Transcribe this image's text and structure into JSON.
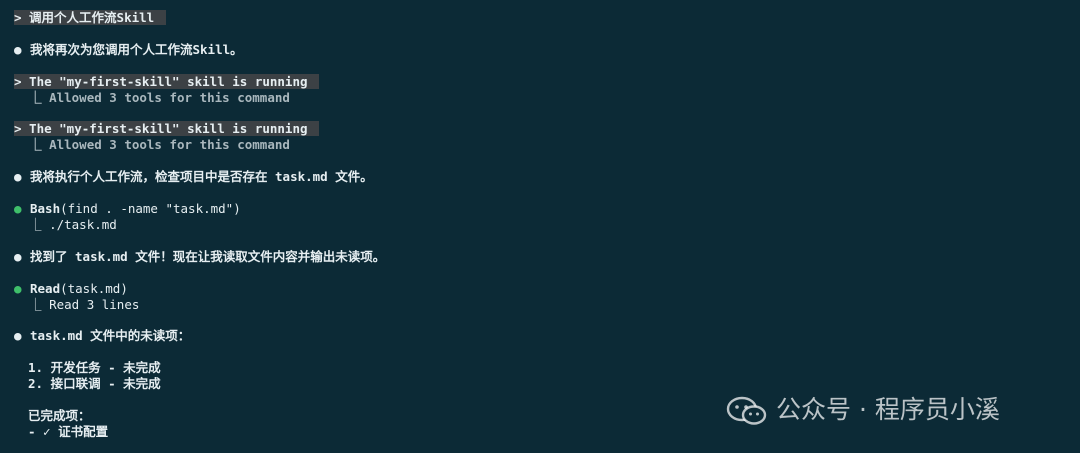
{
  "terminal": {
    "l1": "> 调用个人工作流Skill ",
    "l2": "我将再次为您调用个人工作流Skill。",
    "l3": "> The \"my-first-skill\" skill is running ",
    "l4": "  ⎿ Allowed 3 tools for this command",
    "l5": "> The \"my-first-skill\" skill is running ",
    "l6": "  ⎿ Allowed 3 tools for this command",
    "l7": "我将执行个人工作流，检查项目中是否存在 task.md 文件。",
    "bash_tool": "Bash",
    "bash_args": "(find . -name \"task.md\")",
    "bash_result": "  ⎿ ./task.md",
    "l10": "找到了 task.md 文件！现在让我读取文件内容并输出未读项。",
    "read_tool": "Read",
    "read_args": "(task.md)",
    "read_result": "  ⎿ Read 3 lines",
    "l13": "task.md 文件中的未读项：",
    "item1": "1. 开发任务 - 未完成",
    "item2": "2. 接口联调 - 未完成",
    "done_heading": "已完成项：",
    "done1": "- ✓ 证书配置",
    "bullet": "●"
  },
  "watermark": {
    "text": "公众号 · 程序员小溪",
    "icon": "wechat-icon"
  }
}
